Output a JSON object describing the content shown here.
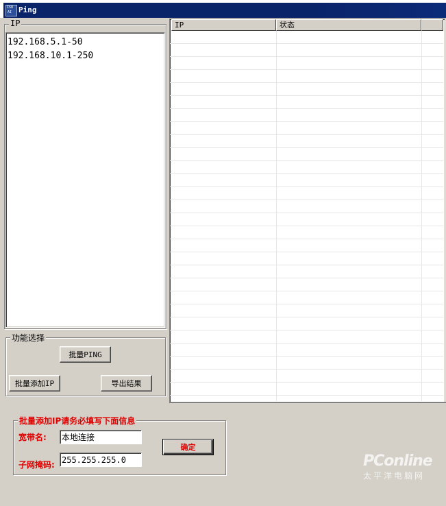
{
  "window": {
    "title": "Ping",
    "icon": "app-icon"
  },
  "ip_group": {
    "legend": "IP",
    "lines": [
      "192.168.5.1-50",
      "192.168.10.1-250"
    ]
  },
  "result_table": {
    "columns": [
      "IP",
      "状态"
    ],
    "rows": []
  },
  "function_group": {
    "legend": "功能选择",
    "batch_ping_label": "批量PING",
    "batch_add_label": "批量添加IP",
    "export_label": "导出结果"
  },
  "batch_add_group": {
    "legend": "批量添加IP请务必填写下面信息",
    "broadband_label": "宽带名:",
    "broadband_value": "本地连接",
    "subnet_label": "子网掩码:",
    "subnet_value": "255.255.255.0",
    "confirm_label": "确定"
  },
  "watermark": {
    "brand": "PConline",
    "subtitle": "太平洋电脑网"
  },
  "colors": {
    "titlebar": "#0a246a",
    "accent_red": "#e00000",
    "face": "#d4d0c8"
  }
}
